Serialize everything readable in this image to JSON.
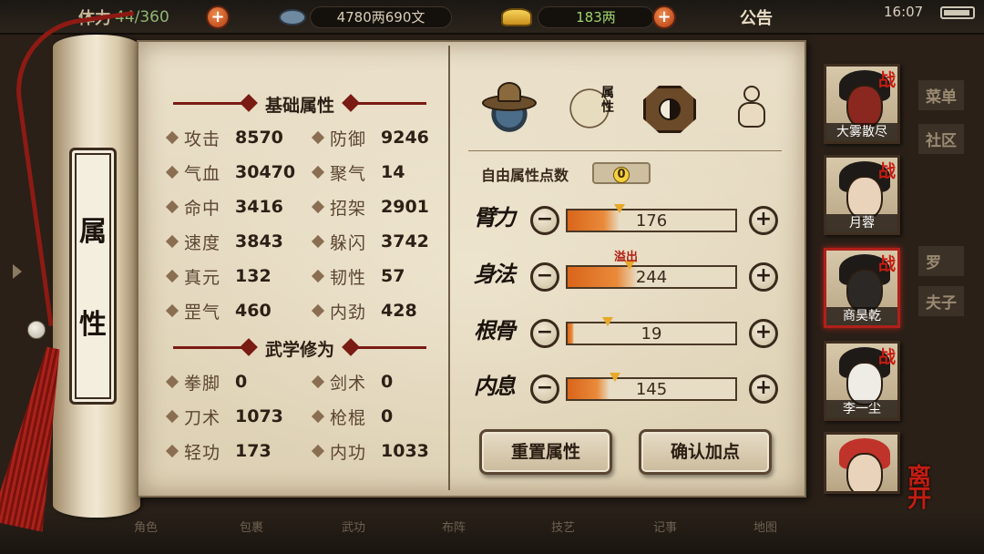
{
  "topbar": {
    "stamina_label": "体力",
    "stamina_value": "44/360",
    "silver": "4780两690文",
    "gold": "183两",
    "notice": "公告",
    "clock": "16:07"
  },
  "bottom_menu": [
    "角色",
    "包裹",
    "武功",
    "布阵",
    "技艺",
    "记事",
    "地图"
  ],
  "background_menu": [
    "菜单",
    "社区",
    "罗",
    "夫子"
  ],
  "scroll_title": [
    "属",
    "性"
  ],
  "basic": {
    "header": "基础属性",
    "stats": [
      {
        "label": "攻击",
        "value": "8570"
      },
      {
        "label": "防御",
        "value": "9246"
      },
      {
        "label": "气血",
        "value": "30470"
      },
      {
        "label": "聚气",
        "value": "14"
      },
      {
        "label": "命中",
        "value": "3416"
      },
      {
        "label": "招架",
        "value": "2901"
      },
      {
        "label": "速度",
        "value": "3843"
      },
      {
        "label": "躲闪",
        "value": "3742"
      },
      {
        "label": "真元",
        "value": "132"
      },
      {
        "label": "韧性",
        "value": "57"
      },
      {
        "label": "罡气",
        "value": "460"
      },
      {
        "label": "内劲",
        "value": "428"
      }
    ]
  },
  "martial": {
    "header": "武学修为",
    "stats": [
      {
        "label": "拳脚",
        "value": "0"
      },
      {
        "label": "剑术",
        "value": "0"
      },
      {
        "label": "刀术",
        "value": "1073"
      },
      {
        "label": "枪棍",
        "value": "0"
      },
      {
        "label": "轻功",
        "value": "173"
      },
      {
        "label": "内功",
        "value": "1033"
      }
    ]
  },
  "tabs": {
    "book_label": "属性",
    "icons": [
      "hat-icon",
      "attribute-book-icon",
      "bagua-icon",
      "meridian-body-icon"
    ]
  },
  "free_points": {
    "label": "自由属性点数",
    "value": "0"
  },
  "attributes": [
    {
      "name": "臂力",
      "value": "176",
      "fill": 0.31,
      "marker": 0.31
    },
    {
      "name": "身法",
      "value": "244",
      "fill": 0.42,
      "marker": 0.37
    },
    {
      "name": "根骨",
      "value": "19",
      "fill": 0.04,
      "marker": 0.24
    },
    {
      "name": "内息",
      "value": "145",
      "fill": 0.25,
      "marker": 0.28
    }
  ],
  "overflow_label": "溢出",
  "buttons": {
    "reset": "重置属性",
    "confirm": "确认加点"
  },
  "party": [
    {
      "name": "大雾散尽",
      "battle": "战",
      "style": "mask-red",
      "selected": false
    },
    {
      "name": "月蓉",
      "battle": "战",
      "style": "",
      "selected": false
    },
    {
      "name": "商昊乾",
      "battle": "战",
      "style": "mask-dark",
      "selected": true
    },
    {
      "name": "李一尘",
      "battle": "战",
      "style": "mask-white",
      "selected": false
    },
    {
      "name": "",
      "battle": "",
      "style": "hat-fest",
      "selected": false
    }
  ],
  "leave": "离开",
  "colors": {
    "accent_red": "#b0201a",
    "bar_fill": "#d9651a",
    "paper": "#e4d8bf"
  }
}
